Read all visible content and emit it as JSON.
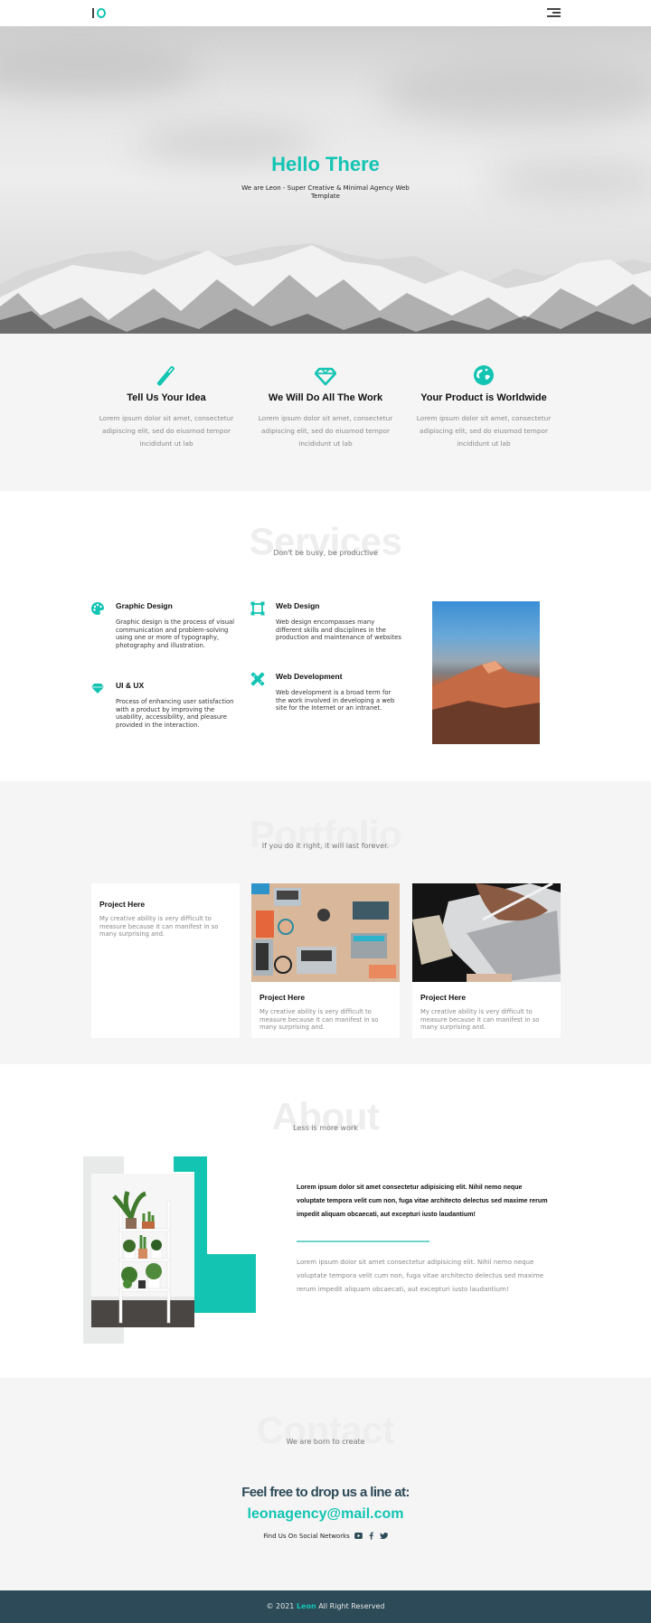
{
  "nav": {
    "logo_alt": "IO",
    "menu_icon": "hamburger-menu-icon"
  },
  "hero": {
    "title": "Hello There",
    "subtitle": "We are Leon - Super Creative & Minimal Agency Web Template"
  },
  "features": [
    {
      "icon": "pencil-icon",
      "title": "Tell Us Your Idea",
      "text": "Lorem ipsum dolor sit amet, consectetur adipiscing elit, sed do eiusmod tempor incididunt ut lab"
    },
    {
      "icon": "diamond-icon",
      "title": "We Will Do All The Work",
      "text": "Lorem ipsum dolor sit amet, consectetur adipiscing elit, sed do eiusmod tempor incididunt ut lab"
    },
    {
      "icon": "globe-icon",
      "title": "Your Product is Worldwide",
      "text": "Lorem ipsum dolor sit amet, consectetur adipiscing elit, sed do eiusmod tempor incididunt ut lab"
    }
  ],
  "services": {
    "heading": "Services",
    "tagline": "Don't be busy, be productive",
    "items": [
      {
        "icon": "palette-icon",
        "title": "Graphic Design",
        "text": "Graphic design is the process of visual communication and problem-solving using one or more of typography, photography and illustration."
      },
      {
        "icon": "vector-square-icon",
        "title": "Web Design",
        "text": "Web design encompasses many different skills and disciplines in the production and maintenance of websites"
      },
      {
        "icon": "gem-icon",
        "title": "UI & UX",
        "text": "Process of enhancing user satisfaction with a product by improving the usability, accessibility, and pleasure provided in the interaction."
      },
      {
        "icon": "pencil-ruler-icon",
        "title": "Web Development",
        "text": "Web development is a broad term for the work involved in developing a web site for the Internet or an intranet."
      }
    ]
  },
  "portfolio": {
    "heading": "Portfolio",
    "tagline": "If you do it right, it will last forever.",
    "cards": [
      {
        "title": "Project Here",
        "text": "My creative ability is very difficult to measure because it can manifest in so many surprising and."
      },
      {
        "title": "Project Here",
        "text": "My creative ability is very difficult to measure because it can manifest in so many surprising and."
      },
      {
        "title": "Project Here",
        "text": "My creative ability is very difficult to measure because it can manifest in so many surprising and."
      }
    ]
  },
  "about": {
    "heading": "About",
    "tagline": "Less is more work",
    "bold_text": "Lorem ipsum dolor sit amet consectetur adipisicing elit. Nihil nemo neque voluptate tempora velit cum non, fuga vitae architecto delectus sed maxime rerum impedit aliquam obcaecati, aut excepturi iusto laudantium!",
    "light_text": "Lorem ipsum dolor sit amet consectetur adipisicing elit. Nihil nemo neque voluptate tempora velit cum non, fuga vitae architecto delectus sed maxime rerum impedit aliquam obcaecati, aut excepturi iusto laudantium!"
  },
  "contact": {
    "heading": "Contact",
    "tagline": "We are born to create",
    "title": "Feel free to drop us a line at:",
    "email": "leonagency@mail.com",
    "social_label": "Find Us On Social Networks",
    "social_icons": [
      "youtube-icon",
      "facebook-icon",
      "twitter-icon"
    ]
  },
  "footer": {
    "prefix": "© 2021",
    "brand": "Leon",
    "suffix": "All Right Reserved"
  },
  "colors": {
    "accent": "#13c4b3",
    "dark": "#2c4a57",
    "section_bg": "#f5f5f5"
  }
}
